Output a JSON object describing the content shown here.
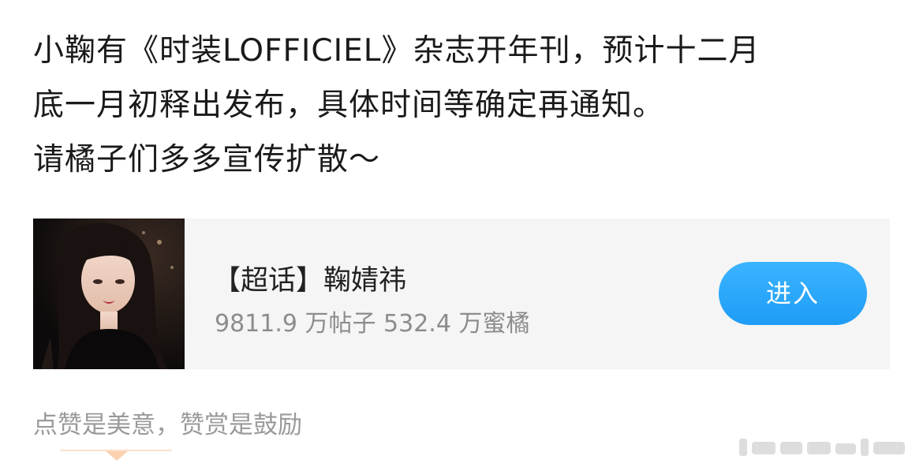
{
  "post": {
    "lines": [
      "小鞠有《时装LOFFICIEL》杂志开年刊，预计十二月",
      "底一月初释出发布，具体时间等确定再通知。",
      "请橘子们多多宣传扩散～"
    ]
  },
  "supertopic_card": {
    "title": "【超话】鞠婧祎",
    "stats": "9811.9 万帖子 532.4 万蜜橘",
    "enter_label": "进入",
    "accent_color": "#2aa5fa"
  },
  "reward": {
    "text": "点赞是美意，赞赏是鼓励"
  }
}
